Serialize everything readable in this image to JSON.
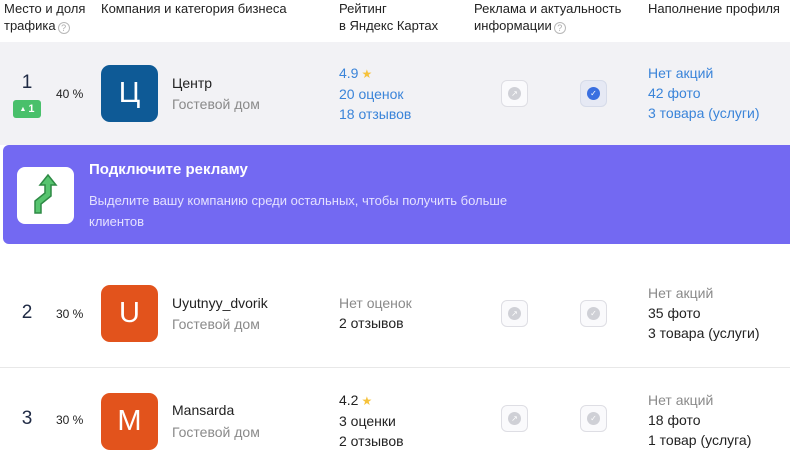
{
  "header": {
    "place_share": [
      "Место и доля",
      "трафика"
    ],
    "company": "Компания и категория бизнеса",
    "rating": [
      "Рейтинг",
      "в Яндекс Картах"
    ],
    "ads": [
      "Реклама и актуальность",
      "информации"
    ],
    "profile": "Наполнение профиля",
    "help_icon": "?"
  },
  "rows": [
    {
      "place": "1",
      "change": "1",
      "share": "40 %",
      "logo_letter": "Ц",
      "logo_color": "#0e5a96",
      "name": "Центр",
      "category": "Гостевой дом",
      "rating": "4.9",
      "reviews_count": "20 оценок",
      "reviews": "18 отзывов",
      "ads_active": false,
      "info_actual": true,
      "promos": "Нет акций",
      "photos": "42 фото",
      "goods": "3 товара (услуги)"
    },
    {
      "place": "2",
      "share": "30 %",
      "logo_letter": "U",
      "logo_color": "#e2531c",
      "name": "Uyutnyy_dvorik",
      "category": "Гостевой дом",
      "rating_none": "Нет оценок",
      "reviews": "2 отзывов",
      "ads_active": false,
      "info_actual": false,
      "promos": "Нет акций",
      "photos": "35 фото",
      "goods": "3 товара (услуги)"
    },
    {
      "place": "3",
      "share": "30 %",
      "logo_letter": "M",
      "logo_color": "#e2531c",
      "name": "Mansarda",
      "category": "Гостевой дом",
      "rating": "4.2",
      "reviews_count": "3 оценки",
      "reviews": "2 отзывов",
      "ads_active": false,
      "info_actual": false,
      "promos": "Нет акций",
      "photos": "18 фото",
      "goods": "1 товар (услуга)"
    }
  ],
  "promo": {
    "title": "Подключите рекламу",
    "text": "Выделите вашу компанию среди остальных, чтобы получить больше клиентов",
    "bg_color": "#7369f2",
    "icon": "growth-arrow-icon"
  },
  "colors": {
    "link": "#3a84d9",
    "badge": "#49c06b",
    "star": "#f6c23b"
  }
}
